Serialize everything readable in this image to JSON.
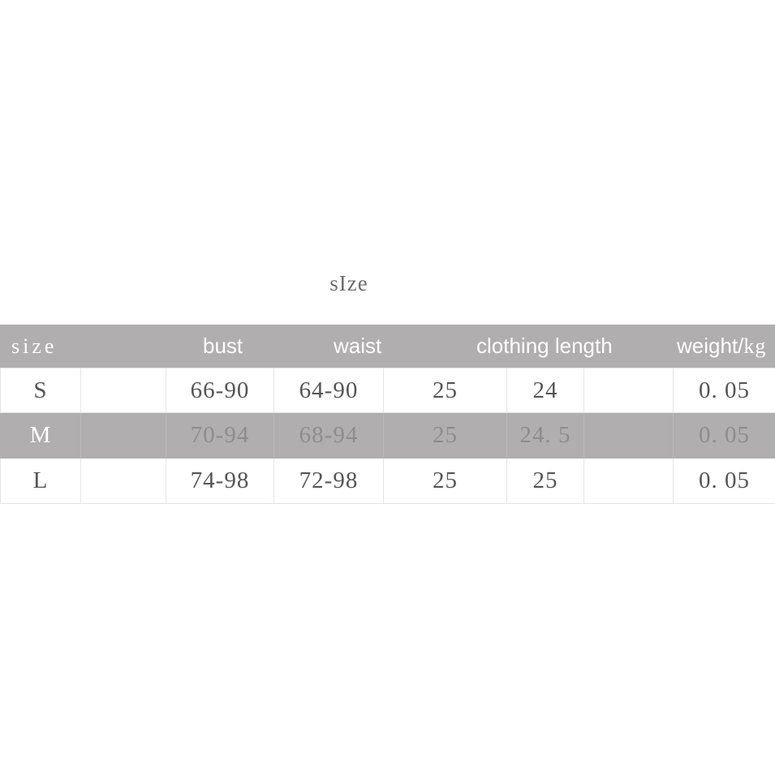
{
  "title": "sIze",
  "colors": {
    "header_band": "#b0aeae",
    "shaded_row": "#b0aeae",
    "grid_line": "#e6e6e6",
    "title_text": "#6e6e6e",
    "header_text": "#ffffff",
    "cell_text": "#555555",
    "shaded_cell_text": "#8e8c8c",
    "page_background": "#ffffff"
  },
  "table": {
    "headers": [
      {
        "label": "size",
        "style": "serif"
      },
      {
        "label": "bust",
        "style": "sans"
      },
      {
        "label": "waist",
        "style": "sans"
      },
      {
        "label": "clothing length",
        "style": "sans"
      },
      {
        "label": "weight/",
        "suffix": "kg",
        "style": "mixed"
      }
    ],
    "rows": [
      {
        "size": "S",
        "shaded": false,
        "cells": [
          "S",
          "",
          "66-90",
          "64-90",
          "25",
          "24",
          "",
          "0. 05"
        ]
      },
      {
        "size": "M",
        "shaded": true,
        "cells": [
          "M",
          "",
          "70-94",
          "68-94",
          "25",
          "24. 5",
          "",
          "0. 05"
        ]
      },
      {
        "size": "L",
        "shaded": false,
        "cells": [
          "L",
          "",
          "74-98",
          "72-98",
          "25",
          "25",
          "",
          "0. 05"
        ]
      }
    ]
  }
}
